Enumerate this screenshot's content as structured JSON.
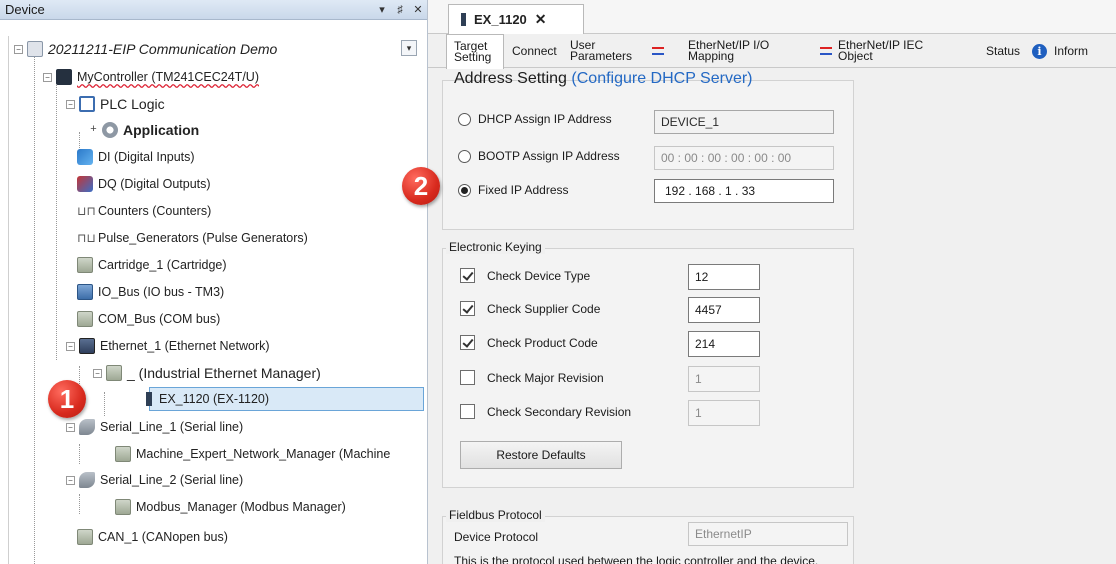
{
  "device_pane": {
    "title": "Device",
    "title_buttons": [
      "▾",
      "♯",
      "✕"
    ],
    "collapse_glyph": "▾",
    "tree": [
      {
        "label": "20211211-EIP Communication Demo",
        "icon": "project-icon",
        "expander": "−"
      },
      {
        "label": "MyController (TM241CEC24T/U)",
        "icon": "controller-icon",
        "expander": "−"
      },
      {
        "label": "PLC Logic",
        "icon": "plc-logic-icon",
        "expander": "−"
      },
      {
        "label": "Application",
        "icon": "gear-icon",
        "expander": "+"
      },
      {
        "label": "DI (Digital Inputs)",
        "icon": "digital-inputs-icon"
      },
      {
        "label": "DQ (Digital Outputs)",
        "icon": "digital-outputs-icon"
      },
      {
        "label": "Counters (Counters)",
        "icon": "counters-icon",
        "glyph": "⊔⊓"
      },
      {
        "label": "Pulse_Generators (Pulse Generators)",
        "icon": "pulse-generator-icon",
        "glyph": "⊓⊔"
      },
      {
        "label": "Cartridge_1 (Cartridge)",
        "icon": "cartridge-icon"
      },
      {
        "label": "IO_Bus (IO bus - TM3)",
        "icon": "io-bus-icon"
      },
      {
        "label": "COM_Bus (COM bus)",
        "icon": "com-bus-icon"
      },
      {
        "label": "Ethernet_1 (Ethernet Network)",
        "icon": "ethernet-icon",
        "expander": "−"
      },
      {
        "label": "_ (Industrial Ethernet Manager)",
        "icon": "ethernet-manager-icon",
        "expander": "−"
      },
      {
        "label": "EX_1120 (EX-1120)",
        "icon": "ex-device-icon"
      },
      {
        "label": "Serial_Line_1 (Serial line)",
        "icon": "serial-line-icon",
        "expander": "−"
      },
      {
        "label": "Machine_Expert_Network_Manager (Machine",
        "icon": "network-manager-icon"
      },
      {
        "label": "Serial_Line_2 (Serial line)",
        "icon": "serial-line-icon",
        "expander": "−"
      },
      {
        "label": "Modbus_Manager (Modbus Manager)",
        "icon": "modbus-manager-icon"
      },
      {
        "label": "CAN_1 (CANopen bus)",
        "icon": "can-bus-icon"
      }
    ]
  },
  "markers": [
    "1",
    "2"
  ],
  "editor": {
    "doc_tab": {
      "label": "EX_1120",
      "close": "✕"
    },
    "sub_tabs": {
      "target_setting_1": "Target",
      "target_setting_2": "Setting",
      "connection": "Connect",
      "user_params_1": "User",
      "user_params_2": "Parameters",
      "io_mapping_1": "EtherNet/IP I/O",
      "io_mapping_2": "Mapping",
      "iec_object_1": "EtherNet/IP IEC",
      "iec_object_2": "Object",
      "status": "Status",
      "information": "Inform",
      "info_glyph": "i"
    },
    "address_setting": {
      "heading": "Address Setting",
      "link": "(Configure DHCP Server)",
      "dhcp_label": "DHCP Assign IP Address",
      "dhcp_value": "DEVICE_1",
      "bootp_label": "BOOTP Assign IP Address",
      "bootp_value": "00 : 00 : 00 : 00 : 00 : 00",
      "fixed_label": "Fixed IP Address",
      "fixed_value": "192 . 168 . 1 . 33",
      "selected": "fixed"
    },
    "electronic_keying": {
      "title": "Electronic Keying",
      "rows": [
        {
          "label": "Check Device Type",
          "checked": true,
          "value": "12"
        },
        {
          "label": "Check Supplier Code",
          "checked": true,
          "value": "4457"
        },
        {
          "label": "Check Product Code",
          "checked": true,
          "value": "214"
        },
        {
          "label": "Check Major Revision",
          "checked": false,
          "value": "1"
        },
        {
          "label": "Check Secondary Revision",
          "checked": false,
          "value": "1"
        }
      ],
      "restore_button": "Restore Defaults"
    },
    "fieldbus_protocol": {
      "title": "Fieldbus Protocol",
      "device_protocol_label": "Device Protocol",
      "device_protocol_value": "EthernetIP",
      "description": "This is the protocol used between the logic controller and the device."
    }
  }
}
